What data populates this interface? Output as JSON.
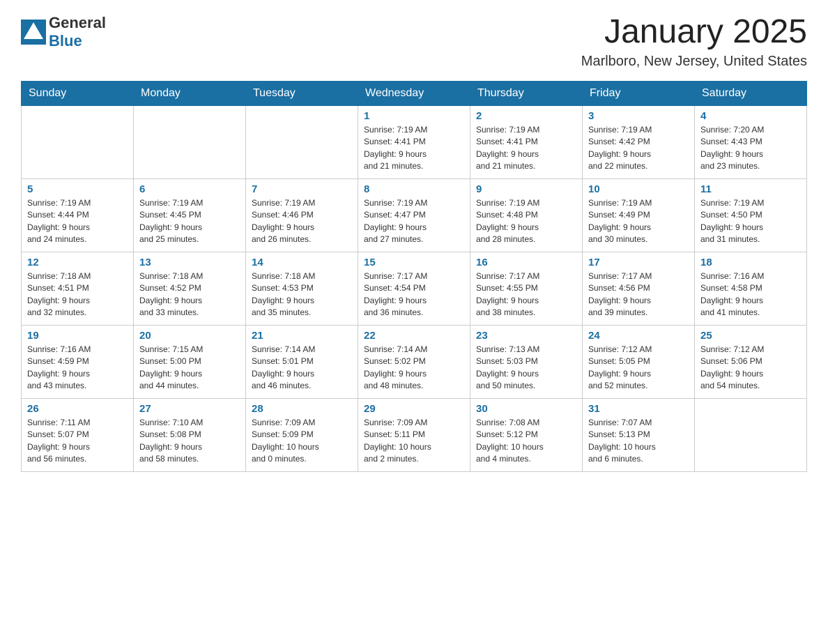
{
  "header": {
    "logo_general": "General",
    "logo_blue": "Blue",
    "month_title": "January 2025",
    "location": "Marlboro, New Jersey, United States"
  },
  "days_of_week": [
    "Sunday",
    "Monday",
    "Tuesday",
    "Wednesday",
    "Thursday",
    "Friday",
    "Saturday"
  ],
  "weeks": [
    [
      {
        "day": "",
        "info": ""
      },
      {
        "day": "",
        "info": ""
      },
      {
        "day": "",
        "info": ""
      },
      {
        "day": "1",
        "info": "Sunrise: 7:19 AM\nSunset: 4:41 PM\nDaylight: 9 hours\nand 21 minutes."
      },
      {
        "day": "2",
        "info": "Sunrise: 7:19 AM\nSunset: 4:41 PM\nDaylight: 9 hours\nand 21 minutes."
      },
      {
        "day": "3",
        "info": "Sunrise: 7:19 AM\nSunset: 4:42 PM\nDaylight: 9 hours\nand 22 minutes."
      },
      {
        "day": "4",
        "info": "Sunrise: 7:20 AM\nSunset: 4:43 PM\nDaylight: 9 hours\nand 23 minutes."
      }
    ],
    [
      {
        "day": "5",
        "info": "Sunrise: 7:19 AM\nSunset: 4:44 PM\nDaylight: 9 hours\nand 24 minutes."
      },
      {
        "day": "6",
        "info": "Sunrise: 7:19 AM\nSunset: 4:45 PM\nDaylight: 9 hours\nand 25 minutes."
      },
      {
        "day": "7",
        "info": "Sunrise: 7:19 AM\nSunset: 4:46 PM\nDaylight: 9 hours\nand 26 minutes."
      },
      {
        "day": "8",
        "info": "Sunrise: 7:19 AM\nSunset: 4:47 PM\nDaylight: 9 hours\nand 27 minutes."
      },
      {
        "day": "9",
        "info": "Sunrise: 7:19 AM\nSunset: 4:48 PM\nDaylight: 9 hours\nand 28 minutes."
      },
      {
        "day": "10",
        "info": "Sunrise: 7:19 AM\nSunset: 4:49 PM\nDaylight: 9 hours\nand 30 minutes."
      },
      {
        "day": "11",
        "info": "Sunrise: 7:19 AM\nSunset: 4:50 PM\nDaylight: 9 hours\nand 31 minutes."
      }
    ],
    [
      {
        "day": "12",
        "info": "Sunrise: 7:18 AM\nSunset: 4:51 PM\nDaylight: 9 hours\nand 32 minutes."
      },
      {
        "day": "13",
        "info": "Sunrise: 7:18 AM\nSunset: 4:52 PM\nDaylight: 9 hours\nand 33 minutes."
      },
      {
        "day": "14",
        "info": "Sunrise: 7:18 AM\nSunset: 4:53 PM\nDaylight: 9 hours\nand 35 minutes."
      },
      {
        "day": "15",
        "info": "Sunrise: 7:17 AM\nSunset: 4:54 PM\nDaylight: 9 hours\nand 36 minutes."
      },
      {
        "day": "16",
        "info": "Sunrise: 7:17 AM\nSunset: 4:55 PM\nDaylight: 9 hours\nand 38 minutes."
      },
      {
        "day": "17",
        "info": "Sunrise: 7:17 AM\nSunset: 4:56 PM\nDaylight: 9 hours\nand 39 minutes."
      },
      {
        "day": "18",
        "info": "Sunrise: 7:16 AM\nSunset: 4:58 PM\nDaylight: 9 hours\nand 41 minutes."
      }
    ],
    [
      {
        "day": "19",
        "info": "Sunrise: 7:16 AM\nSunset: 4:59 PM\nDaylight: 9 hours\nand 43 minutes."
      },
      {
        "day": "20",
        "info": "Sunrise: 7:15 AM\nSunset: 5:00 PM\nDaylight: 9 hours\nand 44 minutes."
      },
      {
        "day": "21",
        "info": "Sunrise: 7:14 AM\nSunset: 5:01 PM\nDaylight: 9 hours\nand 46 minutes."
      },
      {
        "day": "22",
        "info": "Sunrise: 7:14 AM\nSunset: 5:02 PM\nDaylight: 9 hours\nand 48 minutes."
      },
      {
        "day": "23",
        "info": "Sunrise: 7:13 AM\nSunset: 5:03 PM\nDaylight: 9 hours\nand 50 minutes."
      },
      {
        "day": "24",
        "info": "Sunrise: 7:12 AM\nSunset: 5:05 PM\nDaylight: 9 hours\nand 52 minutes."
      },
      {
        "day": "25",
        "info": "Sunrise: 7:12 AM\nSunset: 5:06 PM\nDaylight: 9 hours\nand 54 minutes."
      }
    ],
    [
      {
        "day": "26",
        "info": "Sunrise: 7:11 AM\nSunset: 5:07 PM\nDaylight: 9 hours\nand 56 minutes."
      },
      {
        "day": "27",
        "info": "Sunrise: 7:10 AM\nSunset: 5:08 PM\nDaylight: 9 hours\nand 58 minutes."
      },
      {
        "day": "28",
        "info": "Sunrise: 7:09 AM\nSunset: 5:09 PM\nDaylight: 10 hours\nand 0 minutes."
      },
      {
        "day": "29",
        "info": "Sunrise: 7:09 AM\nSunset: 5:11 PM\nDaylight: 10 hours\nand 2 minutes."
      },
      {
        "day": "30",
        "info": "Sunrise: 7:08 AM\nSunset: 5:12 PM\nDaylight: 10 hours\nand 4 minutes."
      },
      {
        "day": "31",
        "info": "Sunrise: 7:07 AM\nSunset: 5:13 PM\nDaylight: 10 hours\nand 6 minutes."
      },
      {
        "day": "",
        "info": ""
      }
    ]
  ]
}
